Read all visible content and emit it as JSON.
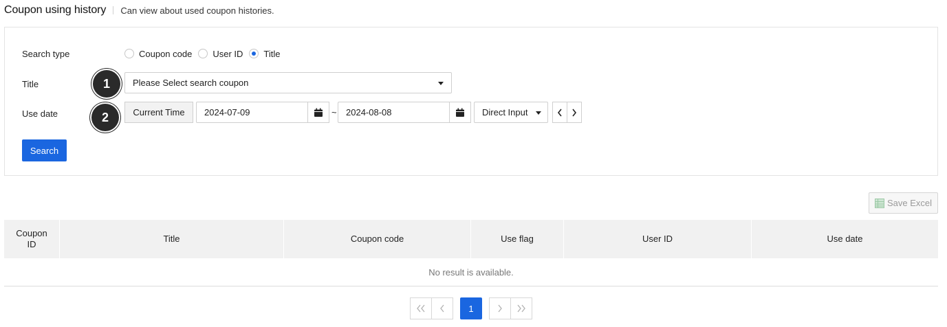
{
  "header": {
    "title": "Coupon using history",
    "description": "Can view about used coupon histories."
  },
  "search": {
    "search_type_label": "Search type",
    "search_type_options": [
      {
        "label": "Coupon code",
        "checked": false
      },
      {
        "label": "User ID",
        "checked": false
      },
      {
        "label": "Title",
        "checked": true
      }
    ],
    "title_label": "Title",
    "title_select_value": "Please Select search coupon",
    "use_date_label": "Use date",
    "current_time_label": "Current Time",
    "date_from": "2024-07-09",
    "date_separator": "~",
    "date_to": "2024-08-08",
    "period_select_value": "Direct Input",
    "search_button_label": "Search"
  },
  "badges": [
    "1",
    "2"
  ],
  "toolbar": {
    "save_excel_label": "Save Excel"
  },
  "table": {
    "columns": [
      "Coupon\nID",
      "Title",
      "Coupon code",
      "Use flag",
      "User ID",
      "Use date"
    ],
    "empty_message": "No result is available."
  },
  "pagination": {
    "current_page": "1"
  },
  "colors": {
    "accent": "#1a66e0",
    "badge": "#2a2a2a",
    "header_bg": "#f1f1f1"
  }
}
